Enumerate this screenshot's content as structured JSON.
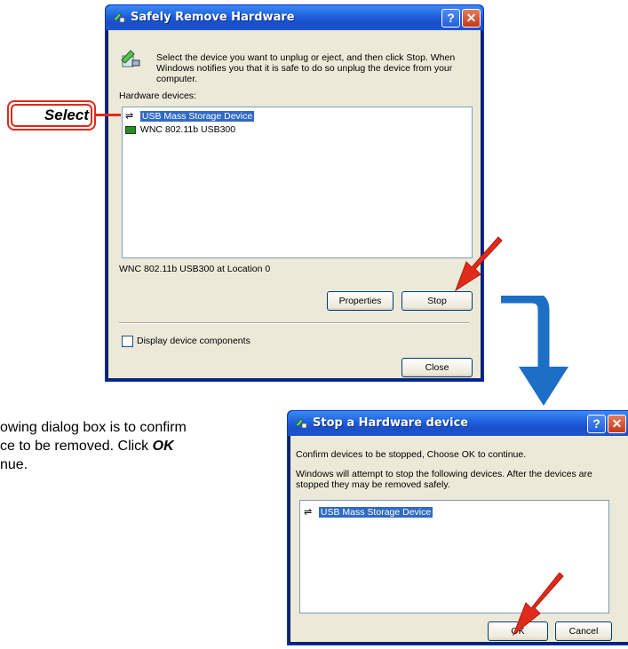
{
  "dialog1": {
    "title": "Safely Remove Hardware",
    "description_lines": [
      "Select the device you want to unplug or eject, and then click Stop. When",
      "Windows notifies you that it is safe to do so unplug the device from your",
      "computer."
    ],
    "devices_label": "Hardware devices:",
    "devices": [
      "USB Mass Storage Device",
      "WNC 802.11b USB300"
    ],
    "selected_device": "USB Mass Storage Device",
    "location_text": "WNC 802.11b USB300 at Location 0",
    "properties_label": "Properties",
    "stop_label": "Stop",
    "checkbox_label": "Display device components",
    "close_label": "Close"
  },
  "callout": {
    "label": "Select"
  },
  "instruction": {
    "line1": "owing dialog box is to confirm",
    "line2_pre": "ce to be removed.  Click ",
    "line2_bold": "OK",
    "line3": "nue."
  },
  "dialog2": {
    "title": "Stop a Hardware device",
    "confirm_text": "Confirm devices to be stopped, Choose OK to continue.",
    "info_lines": [
      "Windows will attempt to stop the following devices. After the devices are",
      "stopped they may be removed safely."
    ],
    "devices": [
      "USB Mass Storage Device"
    ],
    "ok_label": "OK",
    "cancel_label": "Cancel"
  },
  "colors": {
    "accent_red": "#e02a1a",
    "flow_arrow": "#1d6fc6",
    "selection": "#316ac5"
  }
}
